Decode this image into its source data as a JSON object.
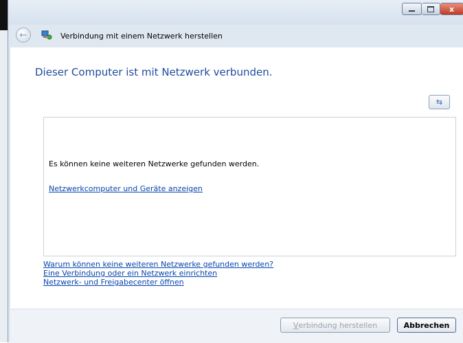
{
  "window": {
    "title": "Verbindung mit einem Netzwerk herstellen",
    "controls": {
      "minimize": "",
      "maximize": "",
      "close": "x"
    }
  },
  "nav": {
    "back_icon": "back-arrow-icon",
    "app_icon": "network-icon"
  },
  "main": {
    "heading": "Dieser Computer ist mit Netzwerk verbunden.",
    "refresh_icon": "refresh-icon",
    "network_list": {
      "message": "Es können keine weiteren Netzwerke gefunden werden.",
      "link": "Netzwerkcomputer und Geräte anzeigen"
    },
    "links": [
      "Warum können keine weiteren Netzwerke gefunden werden?",
      "Eine Verbindung oder ein Netzwerk einrichten",
      "Netzwerk- und Freigabecenter öffnen"
    ]
  },
  "footer": {
    "connect_first_letter": "V",
    "connect_rest": "erbindung herstellen",
    "cancel": "Abbrechen"
  },
  "colors": {
    "heading": "#1e4a9e",
    "link": "#0645ad",
    "frame": "#dfe8f1"
  }
}
